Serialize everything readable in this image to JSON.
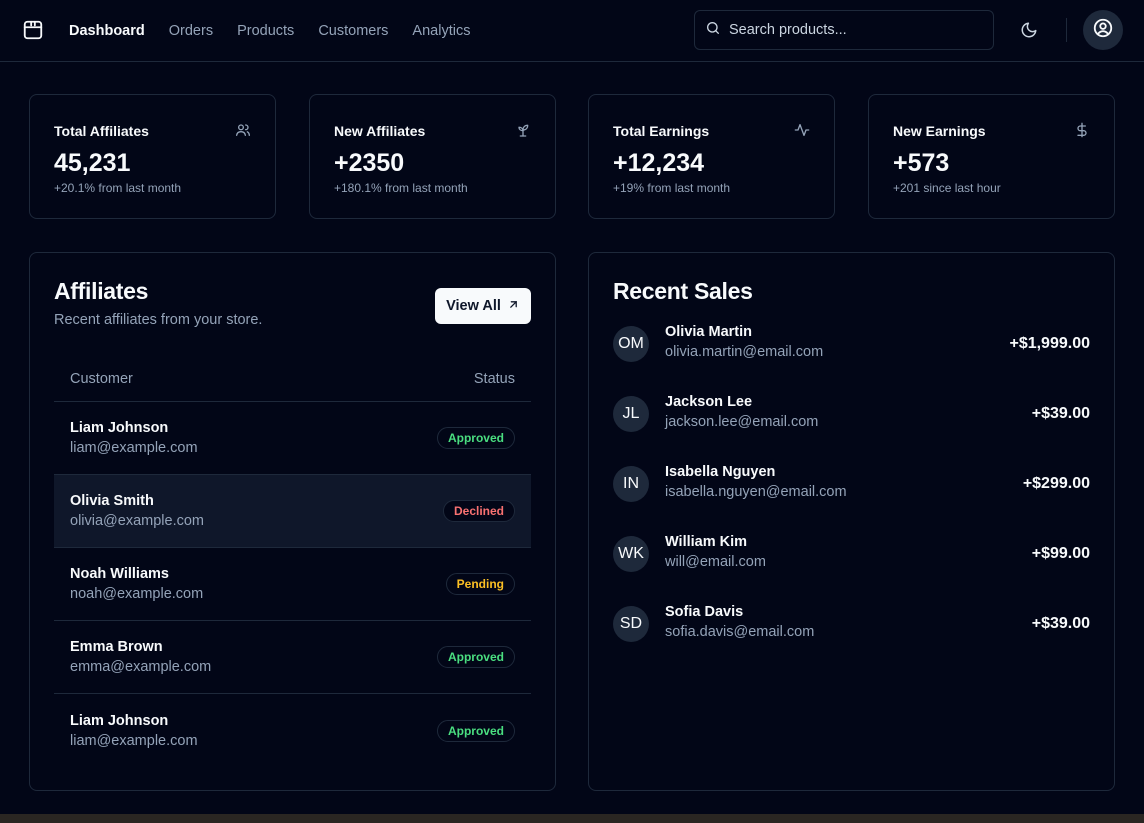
{
  "nav": {
    "items": [
      {
        "label": "Dashboard",
        "active": true
      },
      {
        "label": "Orders",
        "active": false
      },
      {
        "label": "Products",
        "active": false
      },
      {
        "label": "Customers",
        "active": false
      },
      {
        "label": "Analytics",
        "active": false
      }
    ]
  },
  "search": {
    "placeholder": "Search products..."
  },
  "stats": [
    {
      "label": "Total Affiliates",
      "value": "45,231",
      "sub": "+20.1% from last month",
      "icon": "users-icon"
    },
    {
      "label": "New Affiliates",
      "value": "+2350",
      "sub": "+180.1% from last month",
      "icon": "sprout-icon"
    },
    {
      "label": "Total Earnings",
      "value": "+12,234",
      "sub": "+19% from last month",
      "icon": "activity-icon"
    },
    {
      "label": "New Earnings",
      "value": "+573",
      "sub": "+201 since last hour",
      "icon": "dollar-icon"
    }
  ],
  "affiliates": {
    "title": "Affiliates",
    "description": "Recent affiliates from your store.",
    "view_all": "View All",
    "columns": {
      "customer": "Customer",
      "status": "Status"
    },
    "rows": [
      {
        "name": "Liam Johnson",
        "email": "liam@example.com",
        "status": "Approved"
      },
      {
        "name": "Olivia Smith",
        "email": "olivia@example.com",
        "status": "Declined"
      },
      {
        "name": "Noah Williams",
        "email": "noah@example.com",
        "status": "Pending"
      },
      {
        "name": "Emma Brown",
        "email": "emma@example.com",
        "status": "Approved"
      },
      {
        "name": "Liam Johnson",
        "email": "liam@example.com",
        "status": "Approved"
      }
    ]
  },
  "sales": {
    "title": "Recent Sales",
    "items": [
      {
        "initials": "OM",
        "name": "Olivia Martin",
        "email": "olivia.martin@email.com",
        "amount": "+$1,999.00"
      },
      {
        "initials": "JL",
        "name": "Jackson Lee",
        "email": "jackson.lee@email.com",
        "amount": "+$39.00"
      },
      {
        "initials": "IN",
        "name": "Isabella Nguyen",
        "email": "isabella.nguyen@email.com",
        "amount": "+$299.00"
      },
      {
        "initials": "WK",
        "name": "William Kim",
        "email": "will@email.com",
        "amount": "+$99.00"
      },
      {
        "initials": "SD",
        "name": "Sofia Davis",
        "email": "sofia.davis@email.com",
        "amount": "+$39.00"
      }
    ]
  },
  "colors": {
    "background": "#020617",
    "border": "#1e293b",
    "approved": "#4ade80",
    "declined": "#f87171",
    "pending": "#fbbf24"
  }
}
